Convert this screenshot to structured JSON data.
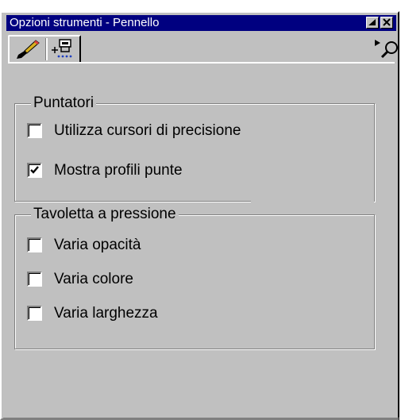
{
  "window": {
    "title": "Opzioni strumenti - Pennello"
  },
  "toolbar": {
    "tabs": [
      {
        "icon": "brush-icon"
      },
      {
        "icon": "spray-nozzle-icon"
      }
    ]
  },
  "groups": {
    "puntatori": {
      "label": "Puntatori",
      "options": [
        {
          "label": "Utilizza cursori di precisione",
          "checked": false
        },
        {
          "label": "Mostra profili punte",
          "checked": true
        }
      ]
    },
    "tavoletta": {
      "label": "Tavoletta a pressione",
      "options": [
        {
          "label": "Varia opacità",
          "checked": false
        },
        {
          "label": "Varia colore",
          "checked": false
        },
        {
          "label": "Varia larghezza",
          "checked": false
        }
      ]
    }
  }
}
